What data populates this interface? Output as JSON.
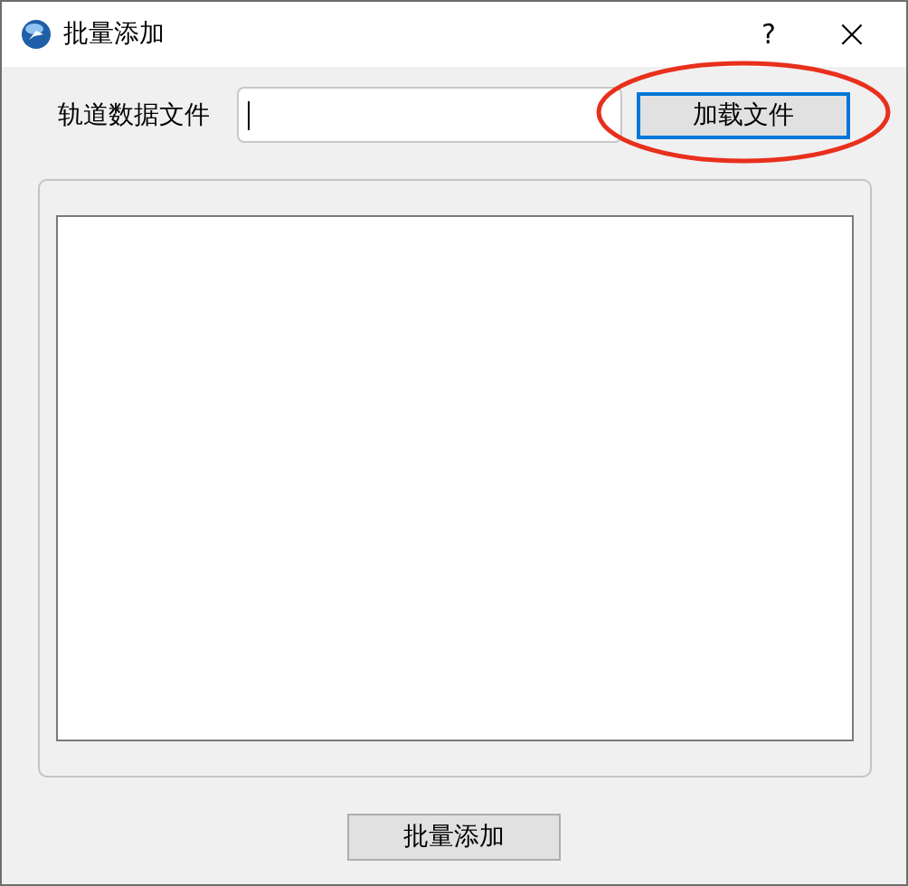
{
  "window": {
    "title": "批量添加",
    "help": "?",
    "close": "×"
  },
  "file_row": {
    "label": "轨道数据文件",
    "button": {
      "label": "加载文件",
      "focused": true
    }
  },
  "annotation": {
    "kind": "ellipse"
  },
  "footer": {
    "button": "批量添加"
  }
}
